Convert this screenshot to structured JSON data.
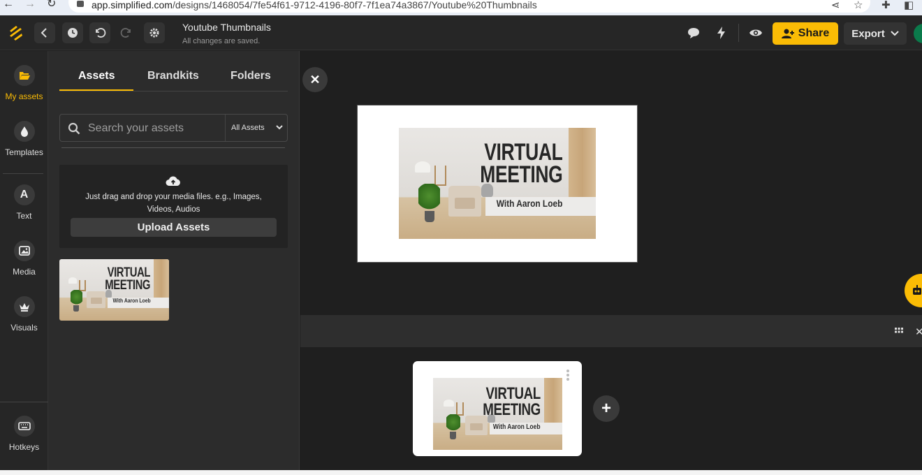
{
  "browser": {
    "url_host": "app.simplified.com",
    "url_path": "/designs/1468054/7fe54f61-9712-4196-80f7-7f1ea74a3867/Youtube%20Thumbnails"
  },
  "topbar": {
    "title": "Youtube Thumbnails",
    "status": "All changes are saved.",
    "share_label": "Share",
    "export_label": "Export"
  },
  "rail": {
    "items": [
      {
        "label": "My assets",
        "icon": "folder-open-icon"
      },
      {
        "label": "Templates",
        "icon": "drop-icon"
      },
      {
        "label": "Text",
        "icon": "text-icon",
        "glyph": "A"
      },
      {
        "label": "Media",
        "icon": "image-icon"
      },
      {
        "label": "Visuals",
        "icon": "crown-icon"
      }
    ],
    "hotkeys_label": "Hotkeys"
  },
  "panel": {
    "tabs": [
      {
        "label": "Assets"
      },
      {
        "label": "Brandkits"
      },
      {
        "label": "Folders"
      }
    ],
    "search_placeholder": "Search your assets",
    "filter_value": "All Assets",
    "drop_hint": "Just drag and drop your media files. e.g., Images, Videos, Audios",
    "upload_label": "Upload Assets"
  },
  "thumbnail": {
    "headline_line1": "VIRTUAL",
    "headline_line2": "MEETING",
    "subline": "With Aaron Loeb"
  },
  "colors": {
    "accent": "#fbbc05",
    "background": "#1f1f1f",
    "panel": "#2c2c2c"
  }
}
